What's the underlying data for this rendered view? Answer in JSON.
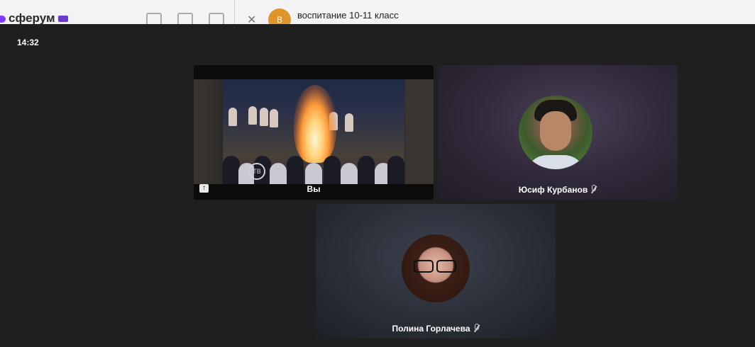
{
  "background_app": {
    "logo_text": "сферум",
    "chat_avatar_letter": "В",
    "chat_title": "воспитание 10-11 класс"
  },
  "call": {
    "time": "14:32",
    "participants": [
      {
        "name": "Вы",
        "video_on": true,
        "screen_sharing": true,
        "muted": false
      },
      {
        "name": "Юсиф Курбанов",
        "video_on": false,
        "muted": true
      },
      {
        "name": "Полина Горлачева",
        "video_on": false,
        "muted": true
      }
    ]
  },
  "colors": {
    "overlay_bg": "#1f1f1f",
    "brand_purple": "#7a3cff",
    "chat_avatar": "#e0952b"
  }
}
